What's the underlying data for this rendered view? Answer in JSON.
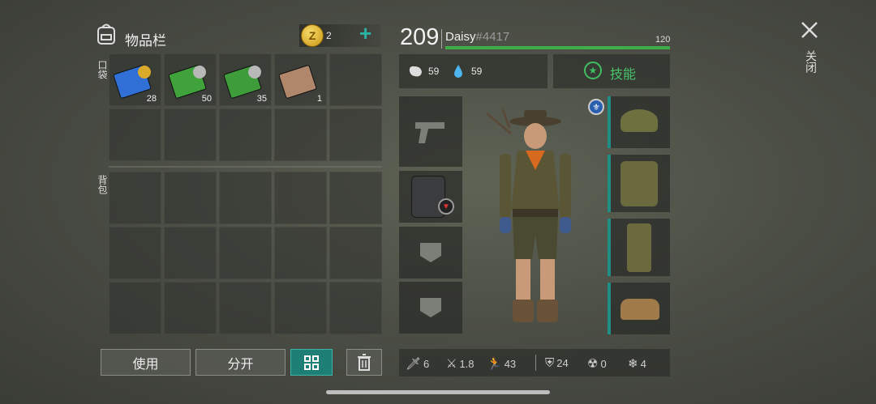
{
  "inventory": {
    "title": "物品栏",
    "coins": "2",
    "add_label": "+",
    "pocket_label": "口袋",
    "backpack_label": "背包",
    "pocket_items": [
      {
        "icon": "blue-card-coin-icon",
        "qty": "28",
        "color": "#2f6fd6"
      },
      {
        "icon": "green-card-coin-icon",
        "qty": "50",
        "color": "#3fa23a"
      },
      {
        "icon": "green-card-coin-icon",
        "qty": "35",
        "color": "#3e9c3a"
      },
      {
        "icon": "brown-card-icon",
        "qty": "1",
        "color": "#b0876a"
      }
    ],
    "use_label": "使用",
    "split_label": "分开"
  },
  "player": {
    "level": "209",
    "name": "Daisy",
    "tag": "#4417",
    "xp_value": "120",
    "food": "59",
    "water": "59",
    "skills_label": "技能"
  },
  "stats": {
    "melee": "6",
    "attack_speed": "1.8",
    "move_speed": "43",
    "armor": "24",
    "radiation": "0",
    "cold": "4"
  },
  "close_label": "关闭",
  "colors": {
    "accent": "#1f8f86",
    "xp_bar": "#3fae49"
  }
}
